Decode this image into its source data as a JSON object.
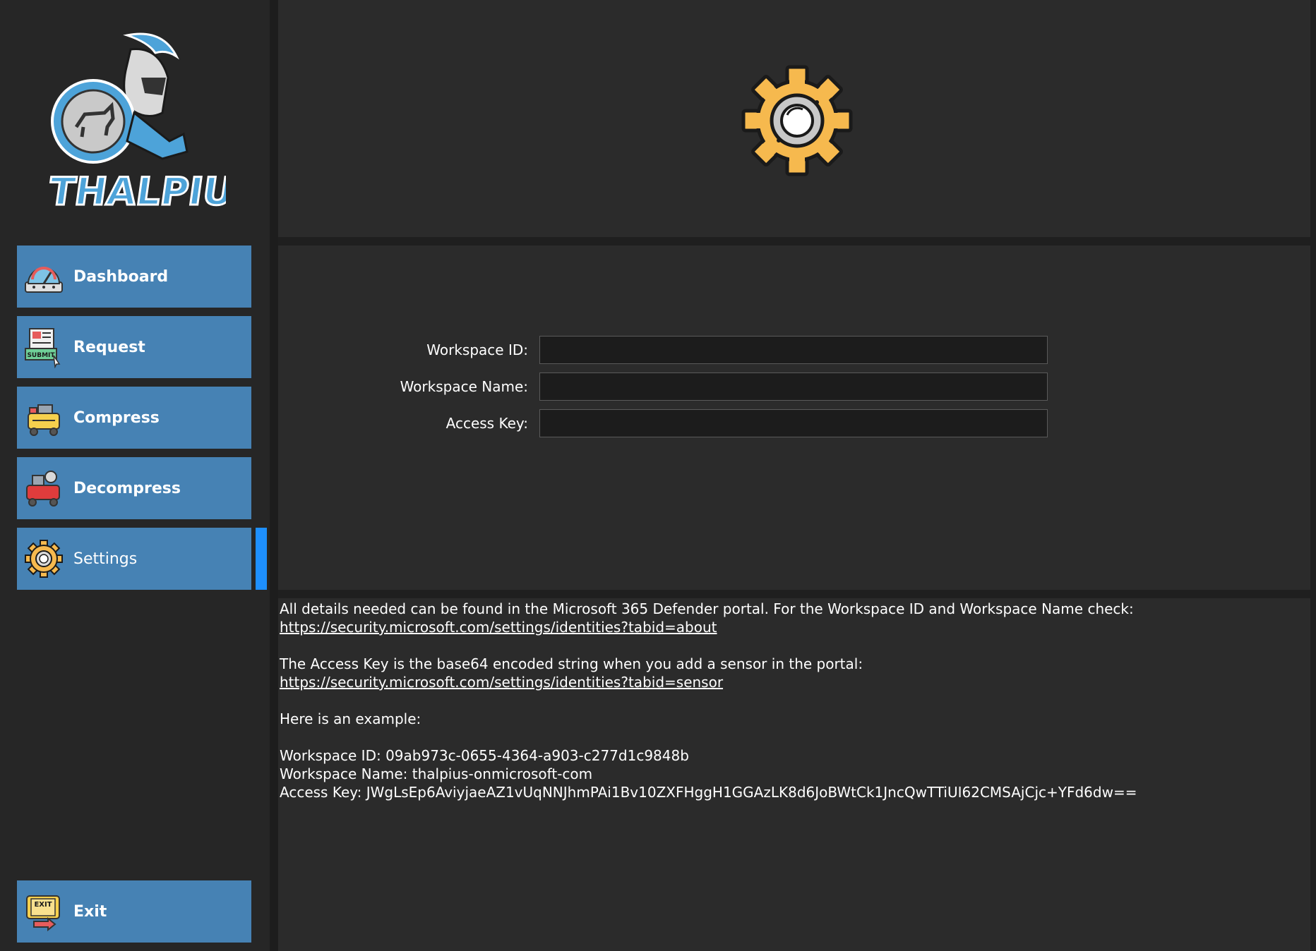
{
  "sidebar": {
    "logo_text": "THALPIUS",
    "items": [
      {
        "label": "Dashboard",
        "icon": "dashboard-gauge-icon"
      },
      {
        "label": "Request",
        "icon": "submit-form-icon"
      },
      {
        "label": "Compress",
        "icon": "compressor-icon"
      },
      {
        "label": "Decompress",
        "icon": "decompressor-icon"
      },
      {
        "label": "Settings",
        "icon": "settings-gear-icon",
        "active": true
      }
    ],
    "exit": {
      "label": "Exit",
      "icon": "exit-sign-icon"
    }
  },
  "header": {
    "icon": "settings-gear-icon"
  },
  "form": {
    "workspace_id": {
      "label": "Workspace ID:",
      "value": ""
    },
    "workspace_name": {
      "label": "Workspace Name:",
      "value": ""
    },
    "access_key": {
      "label": "Access Key:",
      "value": ""
    }
  },
  "info": {
    "line1": "All details needed can be found in the Microsoft 365 Defender portal. For the Workspace ID and Workspace Name check:",
    "link1": "https://security.microsoft.com/settings/identities?tabid=about",
    "line2": "The Access Key is the base64 encoded string when you add a sensor in the portal:",
    "link2": "https://security.microsoft.com/settings/identities?tabid=sensor",
    "line3": "Here is an example:",
    "example_id": "Workspace ID: 09ab973c-0655-4364-a903-c277d1c9848b",
    "example_name": "Workspace Name: thalpius-onmicrosoft-com",
    "example_key": "Access Key: JWgLsEp6AviyjaeAZ1vUqNNJhmPAi1Bv10ZXFHggH1GGAzLK8d6JoBWtCk1JncQwTTiUI62CMSAjCjc+YFd6dw=="
  },
  "colors": {
    "nav_button": "#4682b4",
    "active_indicator": "#1e90ff",
    "panel": "#2b2b2b",
    "sidebar": "#262626",
    "gear": "#f6b94e"
  }
}
